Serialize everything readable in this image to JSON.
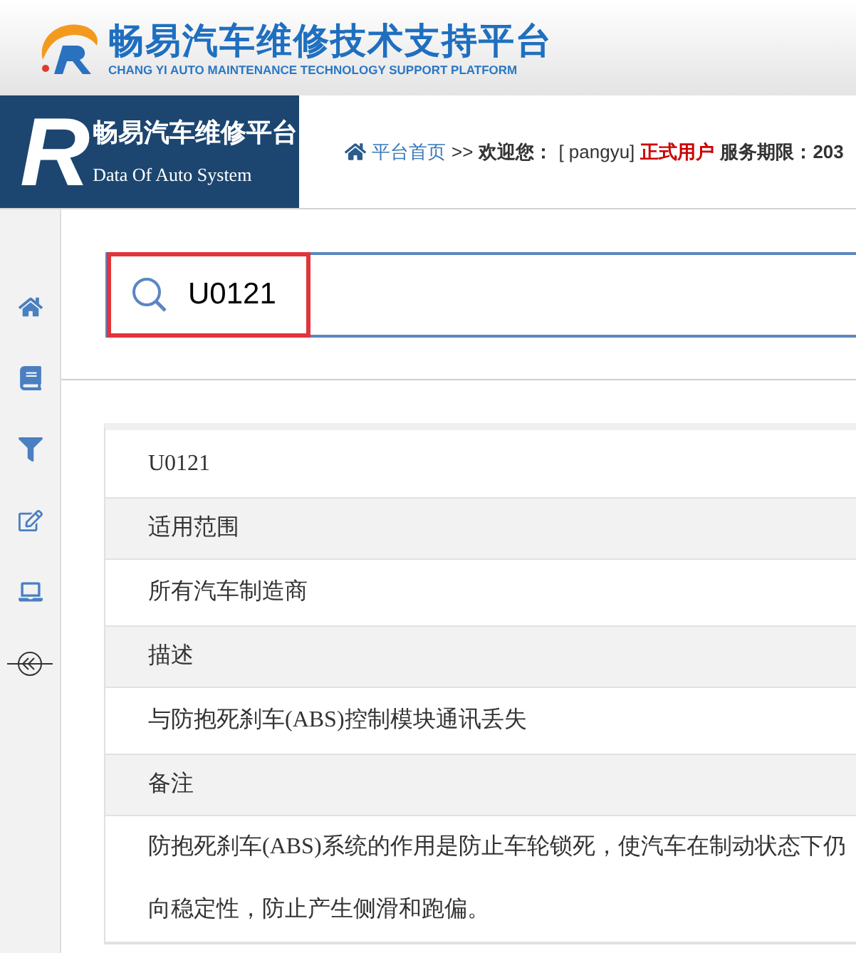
{
  "header": {
    "title": "畅易汽车维修技术支持平台",
    "subtitle": "CHANG YI AUTO MAINTENANCE TECHNOLOGY SUPPORT PLATFORM"
  },
  "brand": {
    "letter": "R",
    "name": "畅易汽车维修平台",
    "tagline": "Data Of Auto System"
  },
  "breadcrumb": {
    "home_link": "平台首页",
    "separator": ">>",
    "welcome": "欢迎您：",
    "user": "[ pangyu]",
    "role": "正式用户",
    "service_label": "服务期限：203"
  },
  "sidebar": {
    "items": [
      {
        "kind": "home"
      },
      {
        "kind": "book"
      },
      {
        "kind": "filter"
      },
      {
        "kind": "edit"
      },
      {
        "kind": "laptop"
      },
      {
        "kind": "collapse"
      }
    ]
  },
  "search": {
    "value": "U0121",
    "highlighted": true
  },
  "rows": [
    {
      "kind": "title",
      "lines": [
        "U0121"
      ]
    },
    {
      "kind": "label",
      "lines": [
        "适用范围"
      ]
    },
    {
      "kind": "value",
      "lines": [
        "所有汽车制造商"
      ]
    },
    {
      "kind": "label",
      "lines": [
        "描述"
      ]
    },
    {
      "kind": "value",
      "lines": [
        "与防抱死刹车(ABS)控制模块通讯丢失"
      ]
    },
    {
      "kind": "label",
      "lines": [
        "备注"
      ]
    },
    {
      "kind": "value",
      "lines": [
        "防抱死刹车(ABS)系统的作用是防止车轮锁死，使汽车在制动状态下仍",
        "向稳定性，防止产生侧滑和跑偏。"
      ]
    }
  ]
}
